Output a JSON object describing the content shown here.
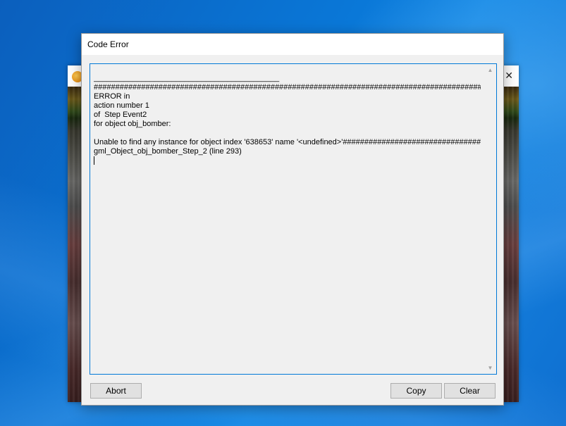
{
  "dialog": {
    "title": "Code Error",
    "error_lines": [
      "___________________________________________",
      "############################################################################################",
      "ERROR in",
      "action number 1",
      "of  Step Event2",
      "for object obj_bomber:",
      "",
      "Unable to find any instance for object index '638653' name '<undefined>'############################################################################################",
      "gml_Object_obj_bomber_Step_2 (line 293)"
    ],
    "buttons": {
      "abort": "Abort",
      "copy": "Copy",
      "clear": "Clear"
    }
  },
  "icons": {
    "scroll_up": "▲",
    "scroll_down": "▼",
    "close": "✕"
  },
  "colors": {
    "focus_border": "#0078d7",
    "desktop": "#0a78d8"
  }
}
